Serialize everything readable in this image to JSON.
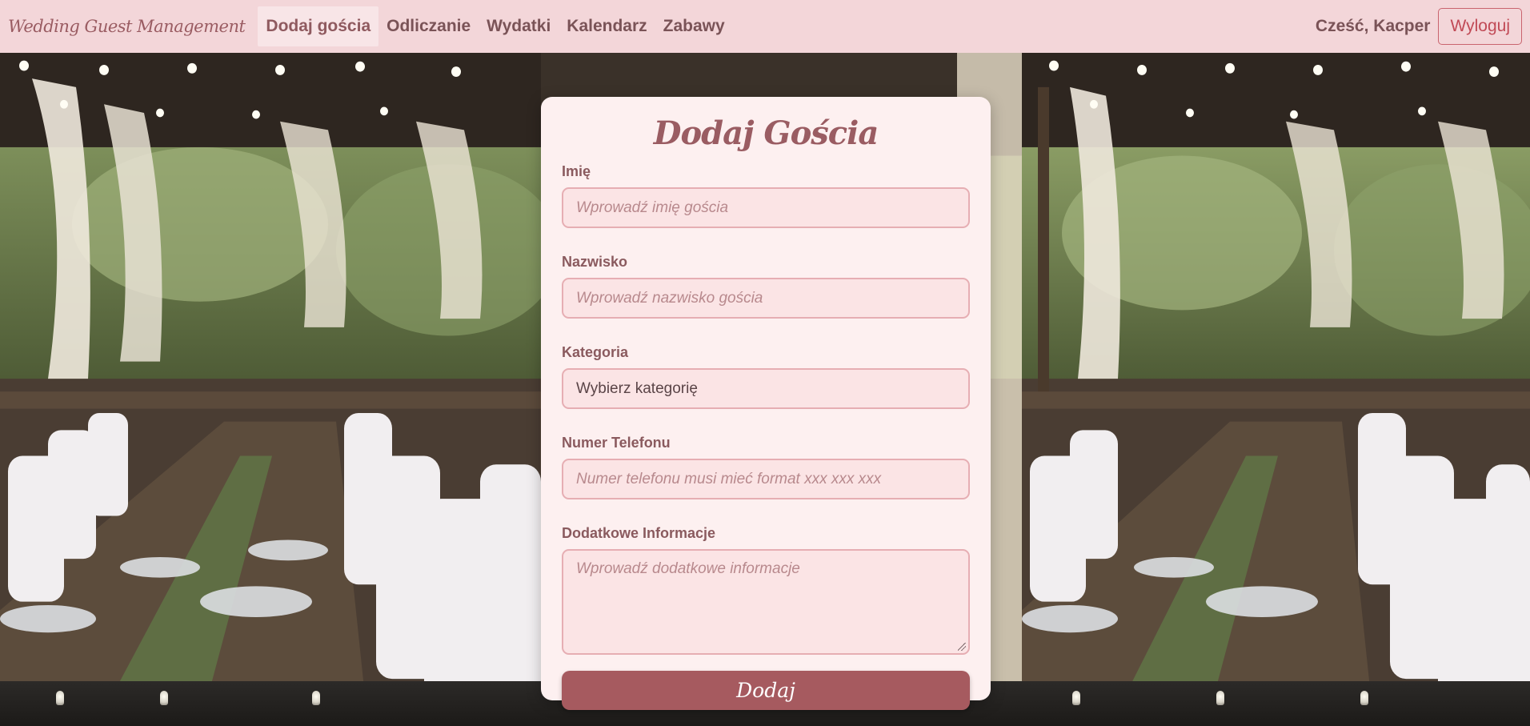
{
  "nav": {
    "brand": "Wedding Guest Management",
    "links": [
      {
        "label": "Dodaj gościa",
        "active": true
      },
      {
        "label": "Odliczanie",
        "active": false
      },
      {
        "label": "Wydatki",
        "active": false
      },
      {
        "label": "Kalendarz",
        "active": false
      },
      {
        "label": "Zabawy",
        "active": false
      }
    ],
    "greeting": "Cześć, Kacper",
    "logout_label": "Wyloguj"
  },
  "form": {
    "title": "Dodaj Gościa",
    "fields": {
      "first_name": {
        "label": "Imię",
        "placeholder": "Wprowadź imię gościa"
      },
      "last_name": {
        "label": "Nazwisko",
        "placeholder": "Wprowadź nazwisko gościa"
      },
      "category": {
        "label": "Kategoria",
        "selected": "Wybierz kategorię"
      },
      "phone": {
        "label": "Numer Telefonu",
        "placeholder": "Numer telefonu musi mieć format xxx xxx xxx"
      },
      "notes": {
        "label": "Dodatkowe Informacje",
        "placeholder": "Wprowadź dodatkowe informacje"
      }
    },
    "submit_label": "Dodaj"
  },
  "colors": {
    "nav_bg": "#f3d6d9",
    "card_bg": "#fdf0f0",
    "accent": "#a65a5f",
    "input_border": "#e6aeb3",
    "logout": "#c14a56"
  }
}
